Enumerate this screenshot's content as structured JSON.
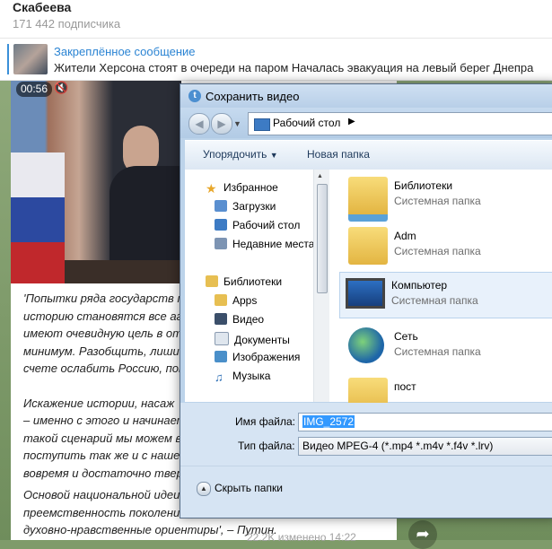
{
  "channel": {
    "name": "Скабеева",
    "subscribers": "171 442 подписчика"
  },
  "pinned": {
    "title": "Закреплённое сообщение",
    "text": "Жители Херсона стоят в очереди на паром   Началась эвакуация на левый берег Днепра"
  },
  "video": {
    "time": "00:56"
  },
  "message": {
    "lines": [
      [
        "'Попытки ряда государств п",
        "историю становятся все аг",
        "имеют очевидную цель в от",
        "минимум. Разобщить, лиши",
        "счете ослабить Россию, пов"
      ],
      [
        "Искажение истории, насаж",
        "– именно с этого и начинает",
        "такой сценарий мы можем в",
        "поступить так же и с нашей",
        "вовремя и достаточно твер"
      ]
    ],
    "last_lines": [
      "Основой национальной идеи",
      "преемственность поколени",
      "духовно-нравственные ориентиры', – Путин."
    ],
    "meta": "22.2K  изменено 14:22"
  },
  "dialog": {
    "title": "Сохранить видео",
    "address": "Рабочий стол",
    "toolbar": {
      "organize": "Упорядочить",
      "new_folder": "Новая папка"
    },
    "tree": {
      "favorites": "Избранное",
      "downloads": "Загрузки",
      "desktop": "Рабочий стол",
      "recent": "Недавние места",
      "libraries": "Библиотеки",
      "apps": "Apps",
      "video": "Видео",
      "documents": "Документы",
      "images": "Изображения",
      "music": "Музыка"
    },
    "files": [
      {
        "name": "Библиотеки",
        "type": "Системная папка"
      },
      {
        "name": "Adm",
        "type": "Системная папка"
      },
      {
        "name": "Компьютер",
        "type": "Системная папка"
      },
      {
        "name": "Сеть",
        "type": "Системная папка"
      },
      {
        "name": "пост",
        "type": ""
      }
    ],
    "filename_label": "Имя файла:",
    "filename_value": "IMG_2572",
    "filetype_label": "Тип файла:",
    "filetype_value": "Видео MPEG-4 (*.mp4 *.m4v *.f4v *.lrv)",
    "hide_folders": "Скрыть папки"
  }
}
